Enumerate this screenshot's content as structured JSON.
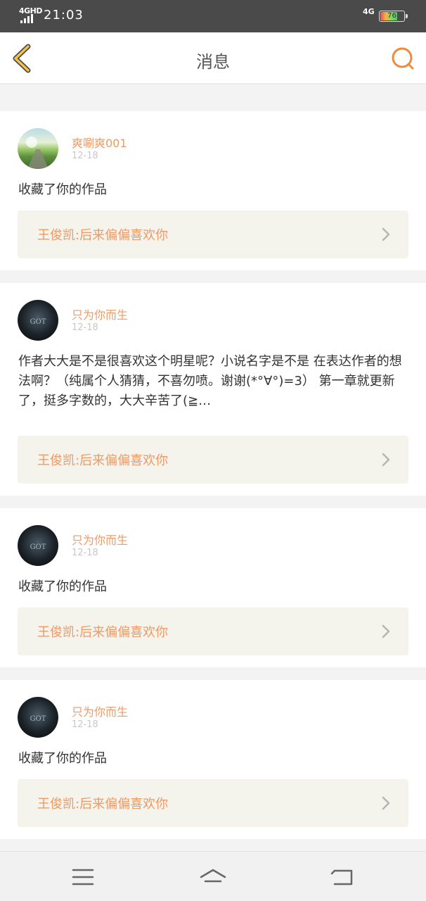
{
  "status_bar": {
    "network_left": "4GHD",
    "time": "21:03",
    "network_right": "4G",
    "battery_level": 76,
    "battery_text": "76"
  },
  "header": {
    "title": "消息",
    "back_icon": "chevron-left-icon",
    "search_icon": "search-icon",
    "accent": "#f08a3c"
  },
  "messages": [
    {
      "username": "爽唰爽001",
      "date": "12-18",
      "text": "收藏了你的作品",
      "work_title": "王俊凯:后来偏偏喜欢你",
      "avatar": "landscape"
    },
    {
      "username": "只为你而生",
      "date": "12-18",
      "text": "作者大大是不是很喜欢这个明星呢？小说名字是不是 在表达作者的想法啊？（纯属个人猜猜，不喜勿喷。谢谢(*°∀°)=3） 第一章就更新了，挺多字数的，大大辛苦了(≧…",
      "work_title": "王俊凯:后来偏偏喜欢你",
      "avatar": "dark"
    },
    {
      "username": "只为你而生",
      "date": "12-18",
      "text": "收藏了你的作品",
      "work_title": "王俊凯:后来偏偏喜欢你",
      "avatar": "dark"
    },
    {
      "username": "只为你而生",
      "date": "12-18",
      "text": "收藏了你的作品",
      "work_title": "王俊凯:后来偏偏喜欢你",
      "avatar": "dark"
    }
  ],
  "colors": {
    "username": "#ee9a66",
    "date": "#c8c8c8",
    "link_bg": "#f4f3ec"
  },
  "bottom_nav": [
    "menu-icon",
    "home-icon",
    "back-icon"
  ]
}
